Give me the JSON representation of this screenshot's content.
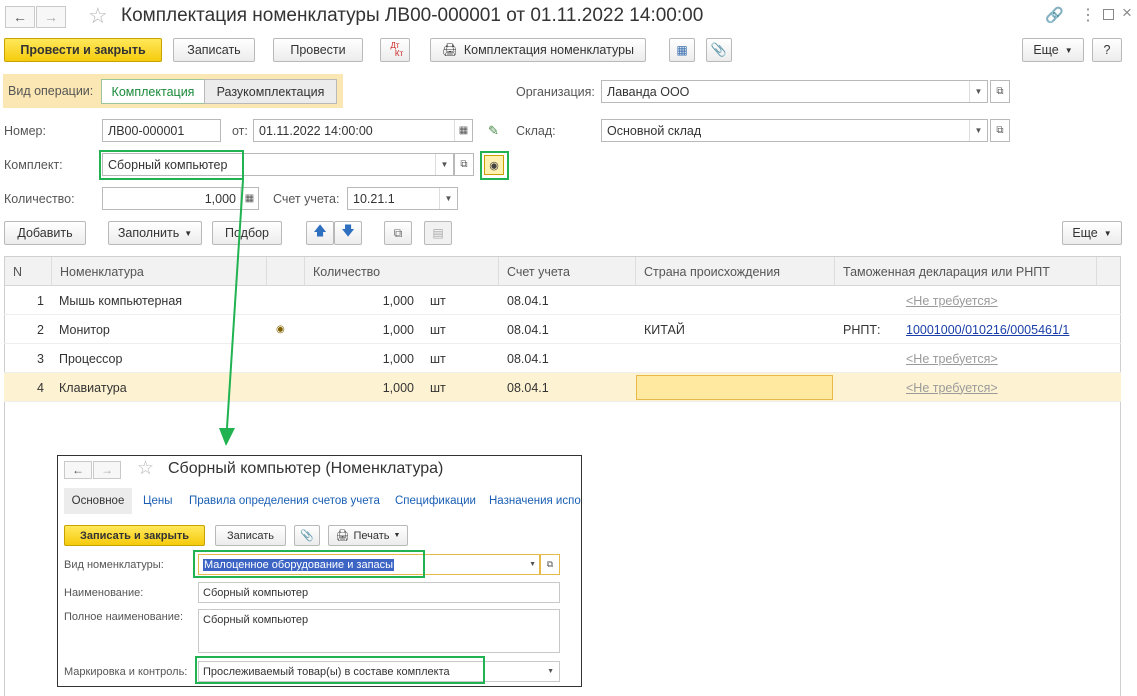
{
  "window": {
    "title": "Комплектация номенклатуры ЛВ00-000001 от 01.11.2022 14:00:00"
  },
  "toolbar": {
    "post_close": "Провести и закрыть",
    "save": "Записать",
    "post": "Провести",
    "dtkt_top": "Дт",
    "dtkt_bottom": "Кт",
    "print_doc": "Комплектация номенклатуры",
    "more": "Еще",
    "help": "?"
  },
  "form": {
    "op_label": "Вид операции:",
    "op_assembly": "Комплектация",
    "op_disassembly": "Разукомплектация",
    "org_label": "Организация:",
    "org_value": "Лаванда ООО",
    "number_label": "Номер:",
    "number_value": "ЛВ00-000001",
    "date_label": "от:",
    "date_value": "01.11.2022 14:00:00",
    "warehouse_label": "Склад:",
    "warehouse_value": "Основной склад",
    "kit_label": "Комплект:",
    "kit_value": "Сборный компьютер",
    "qty_label": "Количество:",
    "qty_value": "1,000",
    "account_label": "Счет учета:",
    "account_value": "10.21.1"
  },
  "table_toolbar": {
    "add": "Добавить",
    "fill": "Заполнить",
    "pick": "Подбор",
    "more": "Еще"
  },
  "table": {
    "headers": [
      "N",
      "Номенклатура",
      "Количество",
      "Счет учета",
      "Страна происхождения",
      "Таможенная декларация или РНПТ"
    ],
    "rows": [
      {
        "n": "1",
        "name": "Мышь компьютерная",
        "qty": "1,000",
        "unit": "шт",
        "account": "08.04.1",
        "country": "",
        "decl_prefix": "",
        "decl": "<Не требуется>"
      },
      {
        "n": "2",
        "name": "Монитор",
        "qty": "1,000",
        "unit": "шт",
        "account": "08.04.1",
        "country": "КИТАЙ",
        "decl_prefix": "РНПТ:",
        "decl": "10001000/010216/0005461/1"
      },
      {
        "n": "3",
        "name": "Процессор",
        "qty": "1,000",
        "unit": "шт",
        "account": "08.04.1",
        "country": "",
        "decl_prefix": "",
        "decl": "<Не требуется>"
      },
      {
        "n": "4",
        "name": "Клавиатура",
        "qty": "1,000",
        "unit": "шт",
        "account": "08.04.1",
        "country": "",
        "decl_prefix": "",
        "decl": "<Не требуется>"
      }
    ]
  },
  "sub": {
    "title": "Сборный компьютер (Номенклатура)",
    "tabs": [
      "Основное",
      "Цены",
      "Правила определения счетов учета",
      "Спецификации",
      "Назначения испо"
    ],
    "save_close": "Записать и закрыть",
    "save": "Записать",
    "print": "Печать",
    "kind_label": "Вид номенклатуры:",
    "kind_value": "Малоценное оборудование и запасы",
    "name_label": "Наименование:",
    "name_value": "Сборный компьютер",
    "fullname_label": "Полное наименование:",
    "fullname_value": "Сборный компьютер",
    "marking_label": "Маркировка и контроль:",
    "marking_value": "Прослеживаемый товар(ы) в составе комплекта"
  },
  "colors": {
    "accent_green": "#21b352",
    "primary_yellow": "#f6cb0d",
    "selected_row": "#fdf3d2"
  }
}
